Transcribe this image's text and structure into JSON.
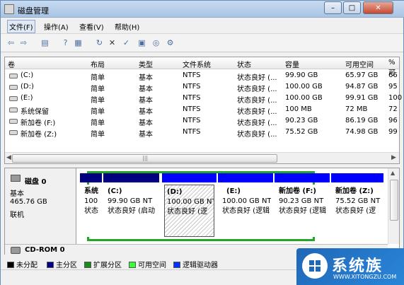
{
  "window": {
    "title": "磁盘管理",
    "min": "–",
    "max": "□",
    "close": "✕"
  },
  "menu": [
    "文件(F)",
    "操作(A)",
    "查看(V)",
    "帮助(H)"
  ],
  "columns": [
    "卷",
    "布局",
    "类型",
    "文件系统",
    "状态",
    "容量",
    "可用空间",
    "% 可"
  ],
  "rows": [
    {
      "vol": "(C:)",
      "layout": "简单",
      "type": "基本",
      "fs": "NTFS",
      "status": "状态良好 (...",
      "cap": "99.90 GB",
      "free": "65.97 GB",
      "pct": "66"
    },
    {
      "vol": "(D:)",
      "layout": "简单",
      "type": "基本",
      "fs": "NTFS",
      "status": "状态良好 (...",
      "cap": "100.00 GB",
      "free": "94.87 GB",
      "pct": "95"
    },
    {
      "vol": "(E:)",
      "layout": "简单",
      "type": "基本",
      "fs": "NTFS",
      "status": "状态良好 (...",
      "cap": "100.00 GB",
      "free": "99.91 GB",
      "pct": "100"
    },
    {
      "vol": "系统保留",
      "layout": "简单",
      "type": "基本",
      "fs": "NTFS",
      "status": "状态良好 (...",
      "cap": "100 MB",
      "free": "72 MB",
      "pct": "72"
    },
    {
      "vol": "新加卷 (F:)",
      "layout": "简单",
      "type": "基本",
      "fs": "NTFS",
      "status": "状态良好 (...",
      "cap": "90.23 GB",
      "free": "86.19 GB",
      "pct": "96"
    },
    {
      "vol": "新加卷 (Z:)",
      "layout": "简单",
      "type": "基本",
      "fs": "NTFS",
      "status": "状态良好 (...",
      "cap": "75.52 GB",
      "free": "74.98 GB",
      "pct": "99"
    }
  ],
  "scroll": {
    "mid": "|||"
  },
  "disk0": {
    "name": "磁盘 0",
    "type": "基本",
    "size": "465.76 GB",
    "state": "联机"
  },
  "partitions": [
    {
      "l1": "系统",
      "l2": "100",
      "l3": "状态"
    },
    {
      "l1": "(C:)",
      "l2": "99.90 GB NT",
      "l3": "状态良好 (启动"
    },
    {
      "l1": "(D:)",
      "l2": "100.00 GB NT",
      "l3": "状态良好 (逻"
    },
    {
      "l1": "(E:)",
      "l2": "100.00 GB NT",
      "l3": "状态良好 (逻辑"
    },
    {
      "l1": "新加卷  (F:)",
      "l2": "90.23 GB NT",
      "l3": "状态良好 (逻辑"
    },
    {
      "l1": "新加卷  (Z:)",
      "l2": "75.52 GB NT",
      "l3": "状态良好 (逻"
    }
  ],
  "cdrom": {
    "name": "CD-ROM 0"
  },
  "legend": [
    {
      "label": "未分配",
      "color": "#000000"
    },
    {
      "label": "主分区",
      "color": "#00008b"
    },
    {
      "label": "扩展分区",
      "color": "#1a8a1a"
    },
    {
      "label": "可用空间",
      "color": "#33ff33"
    },
    {
      "label": "逻辑驱动器",
      "color": "#0033ff"
    }
  ],
  "watermark": {
    "title": "系统族",
    "sub": "WWW.XITONGZU.COM"
  },
  "colors": {
    "primary": "#000080",
    "logical": "#0000ff",
    "extended": "#23a623"
  }
}
